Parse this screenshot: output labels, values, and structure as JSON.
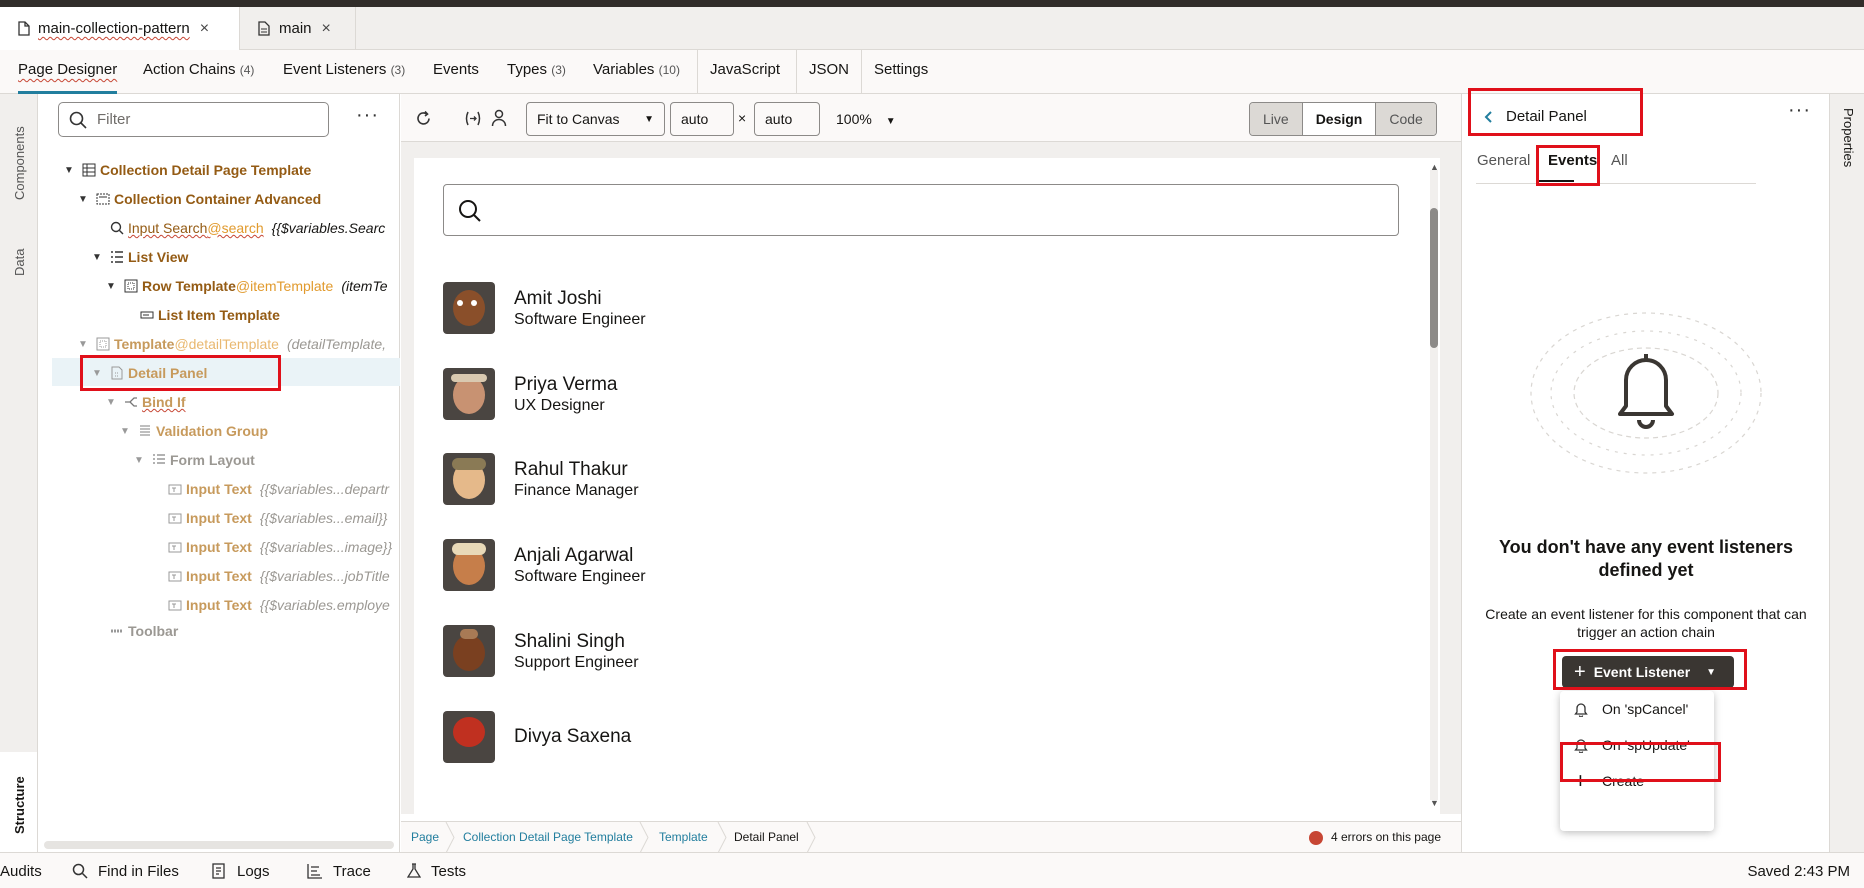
{
  "file_tabs": [
    {
      "label": "main-collection-pattern",
      "close": "×"
    },
    {
      "label": "main",
      "close": "×"
    }
  ],
  "nav_tabs": [
    {
      "label": "Page Designer",
      "count": ""
    },
    {
      "label": "Action Chains",
      "count": "(4)"
    },
    {
      "label": "Event Listeners",
      "count": "(3)"
    },
    {
      "label": "Events",
      "count": ""
    },
    {
      "label": "Types",
      "count": "(3)"
    },
    {
      "label": "Variables",
      "count": "(10)"
    },
    {
      "label": "JavaScript",
      "count": ""
    },
    {
      "label": "JSON",
      "count": ""
    },
    {
      "label": "Settings",
      "count": ""
    }
  ],
  "left_rail": {
    "components": "Components",
    "data": "Data",
    "structure": "Structure"
  },
  "structure": {
    "filter_placeholder": "Filter",
    "more": "···",
    "nodes": [
      {
        "label": "Collection Detail Page Template",
        "attr": "",
        "bind": ""
      },
      {
        "label": "Collection Container Advanced",
        "attr": "",
        "bind": ""
      },
      {
        "label": "Input Search",
        "attr": "@search",
        "bind": "{{$variables.Searc"
      },
      {
        "label": "List View",
        "attr": "",
        "bind": ""
      },
      {
        "label": "Row Template",
        "attr": "@itemTemplate",
        "bind": "(itemTe"
      },
      {
        "label": "List Item Template",
        "attr": "",
        "bind": ""
      },
      {
        "label": "Template",
        "attr": "@detailTemplate",
        "bind": "(detailTemplate,"
      },
      {
        "label": "Detail Panel",
        "attr": "",
        "bind": ""
      },
      {
        "label": "Bind If",
        "attr": "",
        "bind": ""
      },
      {
        "label": "Validation Group",
        "attr": "",
        "bind": ""
      },
      {
        "label": "Form Layout",
        "attr": "",
        "bind": ""
      },
      {
        "label": "Input Text",
        "attr": "",
        "bind": "{{$variables...departr"
      },
      {
        "label": "Input Text",
        "attr": "",
        "bind": "{{$variables...email}}"
      },
      {
        "label": "Input Text",
        "attr": "",
        "bind": "{{$variables...image}}"
      },
      {
        "label": "Input Text",
        "attr": "",
        "bind": "{{$variables...jobTitle"
      },
      {
        "label": "Input Text",
        "attr": "",
        "bind": "{{$variables.employe"
      },
      {
        "label": "Toolbar",
        "attr": "",
        "bind": ""
      }
    ]
  },
  "canvas_toolbar": {
    "fit": "Fit to Canvas",
    "width": "auto",
    "times": "×",
    "height": "auto",
    "zoom": "100%",
    "modes": [
      "Live",
      "Design",
      "Code"
    ]
  },
  "people": [
    {
      "name": "Amit Joshi",
      "title": "Software Engineer"
    },
    {
      "name": "Priya Verma",
      "title": "UX Designer"
    },
    {
      "name": "Rahul Thakur",
      "title": "Finance Manager"
    },
    {
      "name": "Anjali Agarwal",
      "title": "Software Engineer"
    },
    {
      "name": "Shalini Singh",
      "title": "Support Engineer"
    },
    {
      "name": "Divya Saxena",
      "title": ""
    }
  ],
  "breadcrumb": [
    "Page",
    "Collection Detail Page Template",
    "Template",
    "Detail Panel"
  ],
  "errors": "4 errors on this page",
  "properties": {
    "rail_label": "Properties",
    "title": "Detail Panel",
    "more": "···",
    "tabs": [
      "General",
      "Events",
      "All"
    ],
    "empty_title": "You don't have any event listeners defined yet",
    "empty_text": "Create an event listener for this component that can trigger an action chain",
    "button": "Event Listener",
    "menu": [
      "On 'spCancel'",
      "On 'spUpdate'",
      "Create"
    ]
  },
  "status": {
    "items": [
      "Audits",
      "Find in Files",
      "Logs",
      "Trace",
      "Tests"
    ],
    "saved": "Saved 2:43 PM"
  },
  "colors": {
    "accent": "#227e9e",
    "highlight": "#e0101a",
    "node": "#945b14"
  }
}
